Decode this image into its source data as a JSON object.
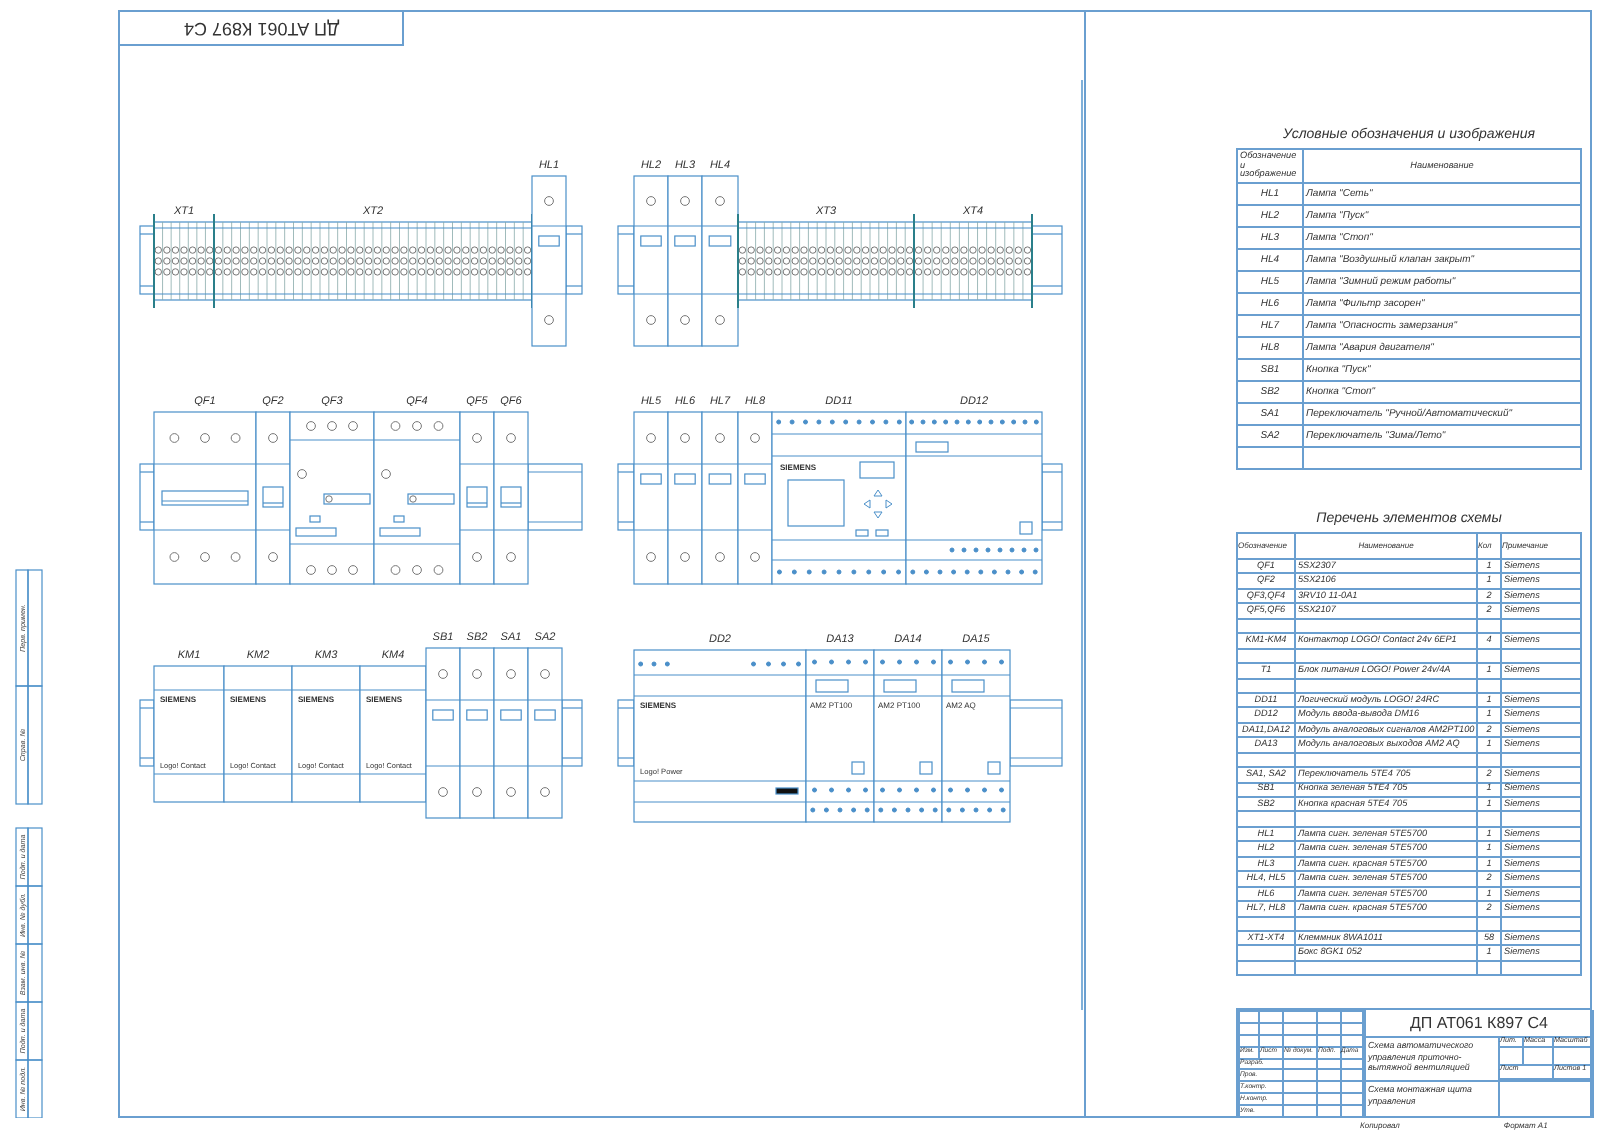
{
  "stamp": "ДП АТ061 К897 С4",
  "side_stamps": {
    "upper": [
      "Перв. примен.",
      "Справ. №"
    ],
    "lower": [
      "Подп. и дата",
      "Инв. № дубл.",
      "Взам. инв. №",
      "Подп. и дата",
      "Инв. № подл."
    ]
  },
  "drawing": {
    "assemblies": [
      {
        "devices": [
          {
            "kind": "terminal",
            "label": "XT1"
          },
          {
            "kind": "terminal",
            "label": "XT2"
          },
          {
            "kind": "pilot_device",
            "label": "HL1"
          }
        ]
      },
      {
        "devices": [
          {
            "kind": "pilot_device",
            "label": "HL2"
          },
          {
            "kind": "pilot_device",
            "label": "HL3"
          },
          {
            "kind": "pilot_device",
            "label": "HL4"
          },
          {
            "kind": "terminal",
            "label": "XT3"
          },
          {
            "kind": "terminal",
            "label": "XT4"
          }
        ]
      },
      {
        "devices": [
          {
            "kind": "breaker3",
            "label": "QF1"
          },
          {
            "kind": "breaker1",
            "label": "QF2"
          },
          {
            "kind": "motor_breaker",
            "label": "QF3"
          },
          {
            "kind": "motor_breaker",
            "label": "QF4"
          },
          {
            "kind": "breaker1",
            "label": "QF5"
          },
          {
            "kind": "breaker1",
            "label": "QF6"
          }
        ]
      },
      {
        "devices": [
          {
            "kind": "pilot_device",
            "label": "HL5"
          },
          {
            "kind": "pilot_device",
            "label": "HL6"
          },
          {
            "kind": "pilot_device",
            "label": "HL7"
          },
          {
            "kind": "pilot_device",
            "label": "HL8"
          },
          {
            "kind": "logic_module",
            "label": "DD11",
            "brand": "SIEMENS"
          },
          {
            "kind": "io_module",
            "label": "DD12"
          }
        ]
      },
      {
        "devices": [
          {
            "kind": "contactor",
            "label": "KM1",
            "brand": "SIEMENS",
            "caption": "Logo! Contact"
          },
          {
            "kind": "contactor",
            "label": "KM2",
            "brand": "SIEMENS",
            "caption": "Logo! Contact"
          },
          {
            "kind": "contactor",
            "label": "KM3",
            "brand": "SIEMENS",
            "caption": "Logo! Contact"
          },
          {
            "kind": "contactor",
            "label": "KM4",
            "brand": "SIEMENS",
            "caption": "Logo! Contact"
          },
          {
            "kind": "pilot_device",
            "label": "SB1"
          },
          {
            "kind": "pilot_device",
            "label": "SB2"
          },
          {
            "kind": "pilot_device",
            "label": "SA1"
          },
          {
            "kind": "pilot_device",
            "label": "SA2"
          }
        ]
      },
      {
        "devices": [
          {
            "kind": "power_supply",
            "label": "DD2",
            "brand": "SIEMENS",
            "caption": "Logo! Power"
          },
          {
            "kind": "analog_module",
            "label": "DA13",
            "model": "AM2 PT100"
          },
          {
            "kind": "analog_module",
            "label": "DA14",
            "model": "AM2 PT100"
          },
          {
            "kind": "analog_module",
            "label": "DA15",
            "model": "AM2 AQ"
          }
        ]
      }
    ]
  },
  "legend": {
    "title": "Условные обозначения и изображения",
    "columns": [
      "Обозначение и изображение",
      "Наименование"
    ],
    "rows": [
      {
        "kind": "item",
        "symbol": "HL1",
        "name": "Лампа \"Сеть\""
      },
      {
        "kind": "item",
        "symbol": "HL2",
        "name": "Лампа \"Пуск\""
      },
      {
        "kind": "item",
        "symbol": "HL3",
        "name": "Лампа \"Стоп\""
      },
      {
        "kind": "item",
        "symbol": "HL4",
        "name": "Лампа \"Воздушный клапан закрыт\""
      },
      {
        "kind": "item",
        "symbol": "HL5",
        "name": "Лампа \"Зимний режим работы\""
      },
      {
        "kind": "item",
        "symbol": "HL6",
        "name": "Лампа \"Фильтр засорен\""
      },
      {
        "kind": "item",
        "symbol": "HL7",
        "name": "Лампа \"Опасность замерзания\""
      },
      {
        "kind": "item",
        "symbol": "HL8",
        "name": "Лампа \"Авария двигателя\""
      },
      {
        "kind": "item",
        "symbol": "SB1",
        "name": "Кнопка \"Пуск\""
      },
      {
        "kind": "item",
        "symbol": "SB2",
        "name": "Кнопка \"Стоп\""
      },
      {
        "kind": "item",
        "symbol": "SA1",
        "name": "Переключатель \"Ручной/Автоматический\""
      },
      {
        "kind": "item",
        "symbol": "SA2",
        "name": "Переключатель \"Зима/Лето\""
      },
      {
        "kind": "spacer"
      }
    ]
  },
  "elements": {
    "title": "Перечень элементов схемы",
    "columns": [
      "Обозначение",
      "Наименование",
      "Кол",
      "Примечание"
    ],
    "rows": [
      {
        "kind": "item",
        "ref": "QF1",
        "name": "5SX2307",
        "qty": "1",
        "note": "Siemens"
      },
      {
        "kind": "item",
        "ref": "QF2",
        "name": "5SX2106",
        "qty": "1",
        "note": "Siemens"
      },
      {
        "kind": "item",
        "ref": "QF3,QF4",
        "name": "3RV10 11-0A1",
        "qty": "2",
        "note": "Siemens"
      },
      {
        "kind": "item",
        "ref": "QF5,QF6",
        "name": "5SX2107",
        "qty": "2",
        "note": "Siemens"
      },
      {
        "kind": "spacer"
      },
      {
        "kind": "item",
        "ref": "KM1-KM4",
        "name": "Контактор LOGO! Contact 24v 6EP1",
        "qty": "4",
        "note": "Siemens"
      },
      {
        "kind": "spacer"
      },
      {
        "kind": "item",
        "ref": "T1",
        "name": "Блок питания LOGO! Power 24v/4A",
        "qty": "1",
        "note": "Siemens"
      },
      {
        "kind": "spacer"
      },
      {
        "kind": "item",
        "ref": "DD11",
        "name": "Логический модуль LOGO! 24RC",
        "qty": "1",
        "note": "Siemens"
      },
      {
        "kind": "item",
        "ref": "DD12",
        "name": "Модуль ввода-вывода DM16",
        "qty": "1",
        "note": "Siemens"
      },
      {
        "kind": "item",
        "ref": "DA11,DA12",
        "name": "Модуль аналоговых сигналов AM2PT100",
        "qty": "2",
        "note": "Siemens"
      },
      {
        "kind": "item",
        "ref": "DA13",
        "name": "Модуль аналоговых выходов AM2 AQ",
        "qty": "1",
        "note": "Siemens"
      },
      {
        "kind": "spacer"
      },
      {
        "kind": "item",
        "ref": "SA1, SA2",
        "name": "Переключатель 5TE4 705",
        "qty": "2",
        "note": "Siemens"
      },
      {
        "kind": "item",
        "ref": "SB1",
        "name": "Кнопка зеленая 5TE4 705",
        "qty": "1",
        "note": "Siemens"
      },
      {
        "kind": "item",
        "ref": "SB2",
        "name": "Кнопка красная 5TE4 705",
        "qty": "1",
        "note": "Siemens"
      },
      {
        "kind": "spacer"
      },
      {
        "kind": "item",
        "ref": "HL1",
        "name": "Лампа сигн. зеленая 5TE5700",
        "qty": "1",
        "note": "Siemens"
      },
      {
        "kind": "item",
        "ref": "HL2",
        "name": "Лампа сигн. зеленая 5TE5700",
        "qty": "1",
        "note": "Siemens"
      },
      {
        "kind": "item",
        "ref": "HL3",
        "name": "Лампа сигн. красная 5TE5700",
        "qty": "1",
        "note": "Siemens"
      },
      {
        "kind": "item",
        "ref": "HL4, HL5",
        "name": "Лампа сигн. зеленая 5TE5700",
        "qty": "2",
        "note": "Siemens"
      },
      {
        "kind": "item",
        "ref": "HL6",
        "name": "Лампа сигн. зеленая 5TE5700",
        "qty": "1",
        "note": "Siemens"
      },
      {
        "kind": "item",
        "ref": "HL7, HL8",
        "name": "Лампа сигн. красная 5TE5700",
        "qty": "2",
        "note": "Siemens"
      },
      {
        "kind": "spacer"
      },
      {
        "kind": "item",
        "ref": "XT1-XT4",
        "name": "Клеммник 8WA1011",
        "qty": "58",
        "note": "Siemens"
      },
      {
        "kind": "item",
        "name": "Бокс 8GK1 052",
        "qty": "1",
        "note": "Siemens"
      },
      {
        "kind": "spacer"
      }
    ]
  },
  "title_block": {
    "document_code": "ДП АТ061 К897 С4",
    "columns": [
      "Изм.",
      "Лист",
      "№ докум.",
      "Подп.",
      "Дата"
    ],
    "roles": [
      "Разраб.",
      "Пров.",
      "Т.контр.",
      "Н.контр.",
      "Утв."
    ],
    "title": "Схема автоматического управления приточно-вытяжной вентиляцией",
    "sheet_name": "Схема монтажная щита управления",
    "stage_headers": [
      "Лит.",
      "Масса",
      "Масштаб"
    ],
    "sheet_label": "Лист",
    "sheets_label": "Листов",
    "sheets_total": "1"
  },
  "footer": {
    "copied": "Копировал",
    "format": "Формат A1"
  }
}
